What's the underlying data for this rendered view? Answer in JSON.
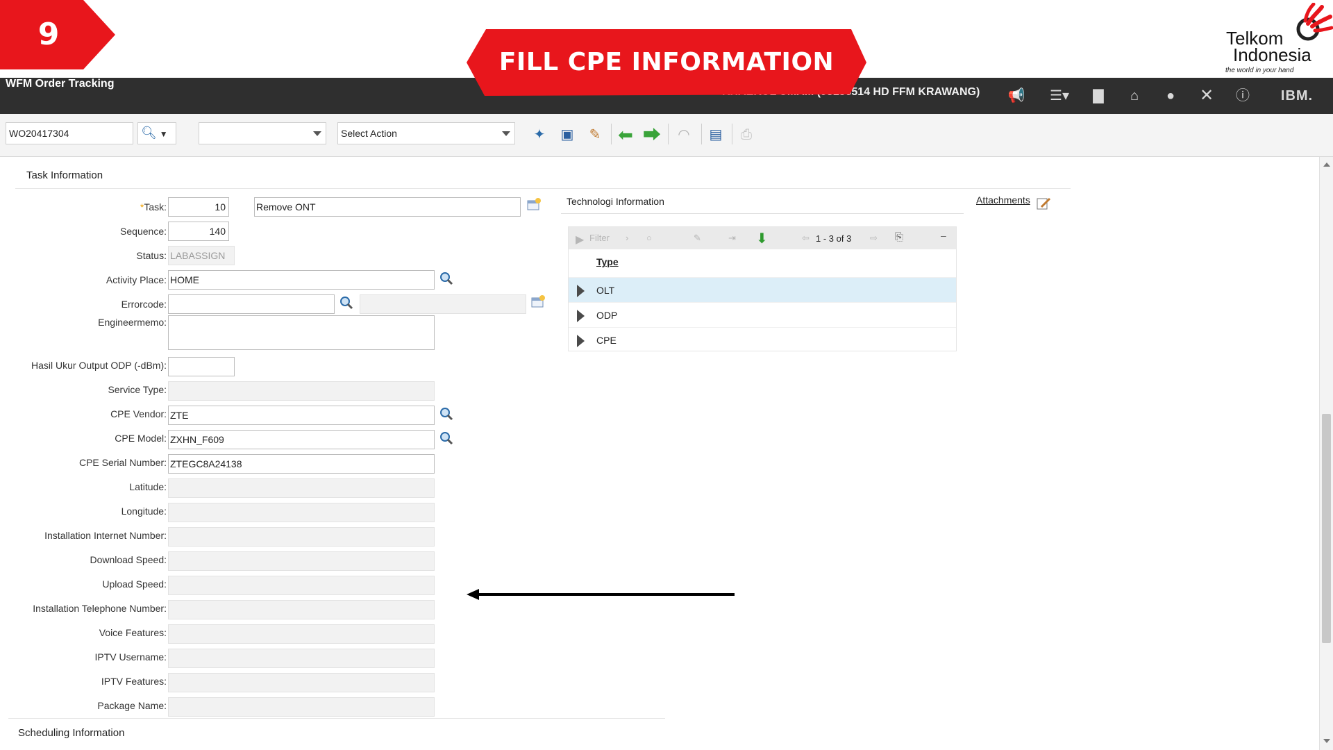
{
  "step": {
    "number": "9"
  },
  "banner": {
    "title": "FILL CPE INFORMATION"
  },
  "logo": {
    "line1": "Telkom",
    "line2": "Indonesia",
    "tagline": "the world in your hand"
  },
  "header": {
    "app_title": "WFM Order Tracking",
    "user": "KHAERUL UMAM (93156514 HD FFM KRAWANG)",
    "icons": [
      "megaphone-icon",
      "bulletin-icon",
      "chart-icon",
      "home-icon",
      "user-icon",
      "close-icon",
      "help-icon",
      "ibm-logo"
    ],
    "vendor_logo_text": "IBM."
  },
  "toolbar": {
    "record_id": "WO20417304",
    "first_select_value": "",
    "action_select_value": "Select Action",
    "icons": [
      "new-record-icon",
      "save-icon",
      "clear-changes-icon",
      "previous-record-icon",
      "next-record-icon",
      "route-workflow-icon",
      "view-history-icon",
      "print-icon"
    ]
  },
  "section": {
    "title": "Task Information"
  },
  "form": {
    "task_label": "Task:",
    "task_value": "10",
    "task_desc": "Remove ONT",
    "sequence_label": "Sequence:",
    "sequence_value": "140",
    "status_label": "Status:",
    "status_value": "LABASSIGN",
    "activity_place_label": "Activity Place:",
    "activity_place_value": "HOME",
    "errorcode_label": "Errorcode:",
    "errorcode_value": "",
    "engineermemo_label": "Engineermemo:",
    "engineermemo_value": "",
    "hasil_ukur_label": "Hasil Ukur Output ODP (-dBm):",
    "hasil_ukur_value": "",
    "service_type_label": "Service Type:",
    "cpe_vendor_label": "CPE Vendor:",
    "cpe_vendor_value": "ZTE",
    "cpe_model_label": "CPE Model:",
    "cpe_model_value": "ZXHN_F609",
    "cpe_serial_label": "CPE Serial Number:",
    "cpe_serial_value": "ZTEGC8A24138",
    "latitude_label": "Latitude:",
    "longitude_label": "Longitude:",
    "install_internet_label": "Installation Internet Number:",
    "download_label": "Download Speed:",
    "upload_label": "Upload Speed:",
    "install_phone_label": "Installation Telephone Number:",
    "voice_label": "Voice Features:",
    "iptv_user_label": "IPTV Username:",
    "iptv_feat_label": "IPTV Features:",
    "package_label": "Package Name:"
  },
  "tech": {
    "title": "Technologi Information",
    "filter_label": "Filter",
    "count": "1 - 3 of 3",
    "column": "Type",
    "rows": [
      {
        "type": "OLT",
        "selected": true
      },
      {
        "type": "ODP",
        "selected": false
      },
      {
        "type": "CPE",
        "selected": false
      }
    ]
  },
  "attachments": {
    "label": "Attachments"
  },
  "scheduling": {
    "title": "Scheduling Information"
  },
  "colors": {
    "brand_red": "#e8161c",
    "header_dark": "#2f2f2f",
    "selected_row": "#dceef8"
  }
}
